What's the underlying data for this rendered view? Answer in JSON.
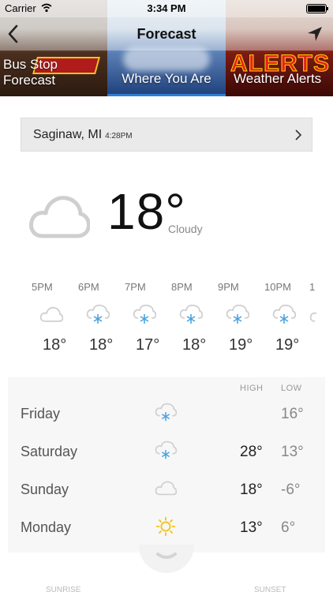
{
  "status": {
    "carrier": "Carrier",
    "time": "3:34 PM"
  },
  "nav": {
    "title": "Forecast"
  },
  "tiles": [
    {
      "label_line1": "Bus Stop",
      "label_line2": "Forecast"
    },
    {
      "label": "Where You Are"
    },
    {
      "label": "Weather Alerts",
      "art_text": "ALERTS"
    }
  ],
  "location": {
    "city": "Saginaw, MI",
    "time": "4:28PM"
  },
  "current": {
    "temp": "18°",
    "condition": "Cloudy",
    "icon": "cloud-icon"
  },
  "hourly": [
    {
      "time": "5PM",
      "temp": "18°",
      "icon": "cloud-icon"
    },
    {
      "time": "6PM",
      "temp": "18°",
      "icon": "cloud-snow-icon"
    },
    {
      "time": "7PM",
      "temp": "17°",
      "icon": "cloud-snow-icon"
    },
    {
      "time": "8PM",
      "temp": "18°",
      "icon": "cloud-snow-icon"
    },
    {
      "time": "9PM",
      "temp": "19°",
      "icon": "cloud-snow-icon"
    },
    {
      "time": "10PM",
      "temp": "19°",
      "icon": "cloud-snow-icon"
    },
    {
      "time": "1",
      "temp": "",
      "icon": "cloud-icon"
    }
  ],
  "daily": {
    "high_label": "HIGH",
    "low_label": "LOW",
    "days": [
      {
        "name": "Friday",
        "high": "",
        "low": "16°",
        "icon": "cloud-snow-icon"
      },
      {
        "name": "Saturday",
        "high": "28°",
        "low": "13°",
        "icon": "cloud-snow-icon"
      },
      {
        "name": "Sunday",
        "high": "18°",
        "low": "-6°",
        "icon": "cloud-icon"
      },
      {
        "name": "Monday",
        "high": "13°",
        "low": "6°",
        "icon": "sun-icon"
      }
    ]
  },
  "footer": {
    "sunrise": "SUNRISE",
    "sunset": "SUNSET"
  },
  "colors": {
    "accent": "#2f7fd6",
    "snow": "#4aa3df",
    "sun": "#f2c41a",
    "cloud": "#cfcfcf"
  }
}
